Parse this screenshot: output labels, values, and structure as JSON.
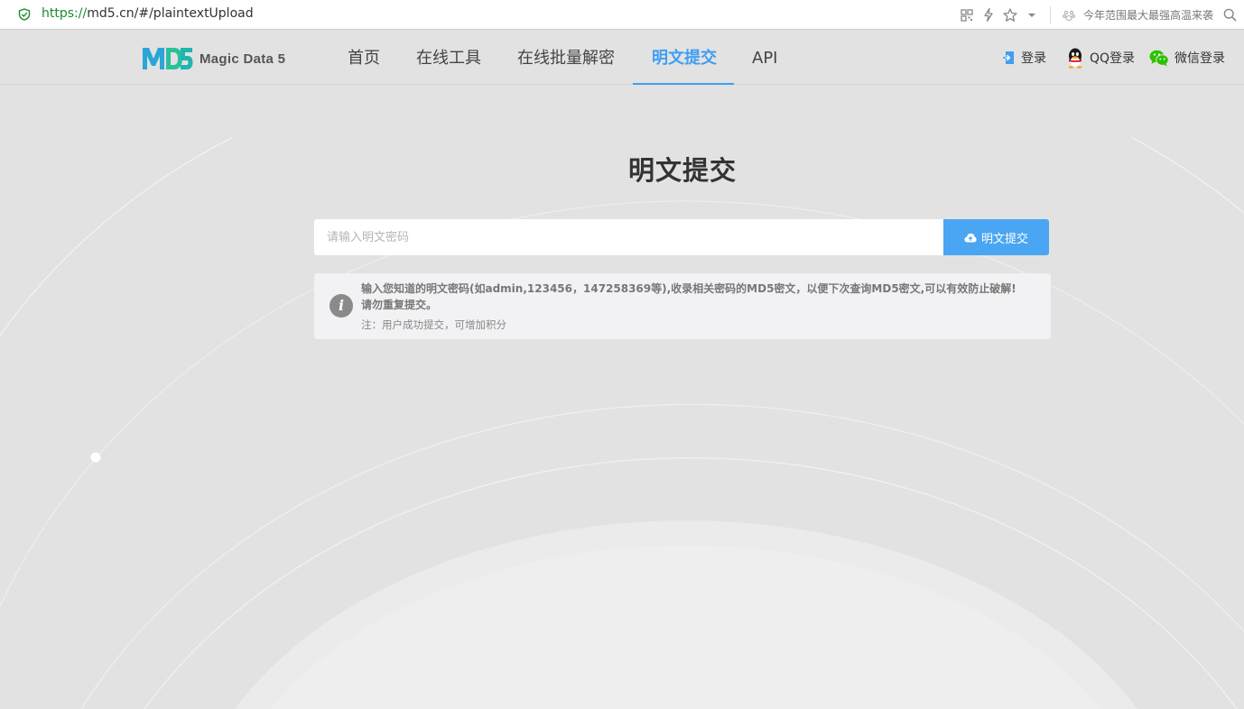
{
  "browser": {
    "url_scheme": "https://",
    "url_rest": "md5.cn/#/plaintextUpload",
    "news_text": "今年范围最大最强高温来袭",
    "icons": [
      "qr-code-icon",
      "lightning-icon",
      "star-icon",
      "dropdown-icon",
      "paw-icon",
      "search-icon"
    ]
  },
  "nav": {
    "logo_text": "Magic Data 5",
    "items": [
      {
        "label": "首页",
        "active": false
      },
      {
        "label": "在线工具",
        "active": false
      },
      {
        "label": "在线批量解密",
        "active": false
      },
      {
        "label": "明文提交",
        "active": true
      },
      {
        "label": "API",
        "active": false
      }
    ],
    "login_label": "登录",
    "qq_login_label": "QQ登录",
    "wechat_login_label": "微信登录"
  },
  "main": {
    "title": "明文提交",
    "input_placeholder": "请输入明文密码",
    "input_value": "",
    "submit_label": "明文提交",
    "notice_line1": "输入您知道的明文密码(如admin,123456，147258369等),收录相关密码的MD5密文，以便下次查询MD5密文,可以有效防止破解!",
    "notice_line2": "请勿重复提交。",
    "notice_note": "注：用户成功提交，可增加积分"
  },
  "colors": {
    "accent": "#3f9ef2",
    "button": "#4aa6f2",
    "background": "#e2e2e2",
    "url_green": "#1b8a2b"
  }
}
